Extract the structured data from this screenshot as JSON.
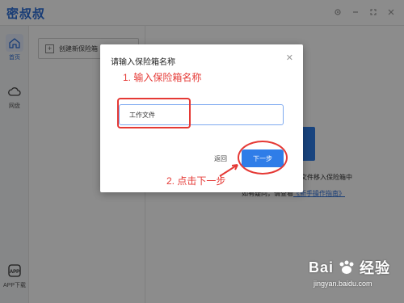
{
  "app": {
    "title": "密叔叔",
    "controls": [
      "gear-icon",
      "minimize-icon",
      "maximize-icon",
      "close-icon"
    ]
  },
  "sidebar": {
    "items": [
      {
        "label": "首页",
        "icon": "home-icon",
        "active": true
      },
      {
        "label": "网盘",
        "icon": "cloud-icon",
        "active": false
      },
      {
        "label": "APP下载",
        "icon": "app-download-icon",
        "active": false
      }
    ]
  },
  "main": {
    "create_button_label": "创建新保险箱",
    "bg_text_1": "的文件移入保险箱中",
    "bg_text_2_prefix": "如有疑问，请查看",
    "bg_text_2_link": "《新手操作指南》"
  },
  "dialog": {
    "title": "请输入保险箱名称",
    "input_value": "工作文件",
    "back_label": "返回",
    "next_label": "下一步"
  },
  "annotations": {
    "step1": "1. 输入保险箱名称",
    "step2": "2. 点击下一步",
    "color": "#e53935"
  },
  "watermark": {
    "brand": "Bai",
    "brand_suffix": "经验",
    "url": "jingyan.baidu.com"
  },
  "colors": {
    "accent": "#2f7de8",
    "title": "#2f6fd8"
  }
}
